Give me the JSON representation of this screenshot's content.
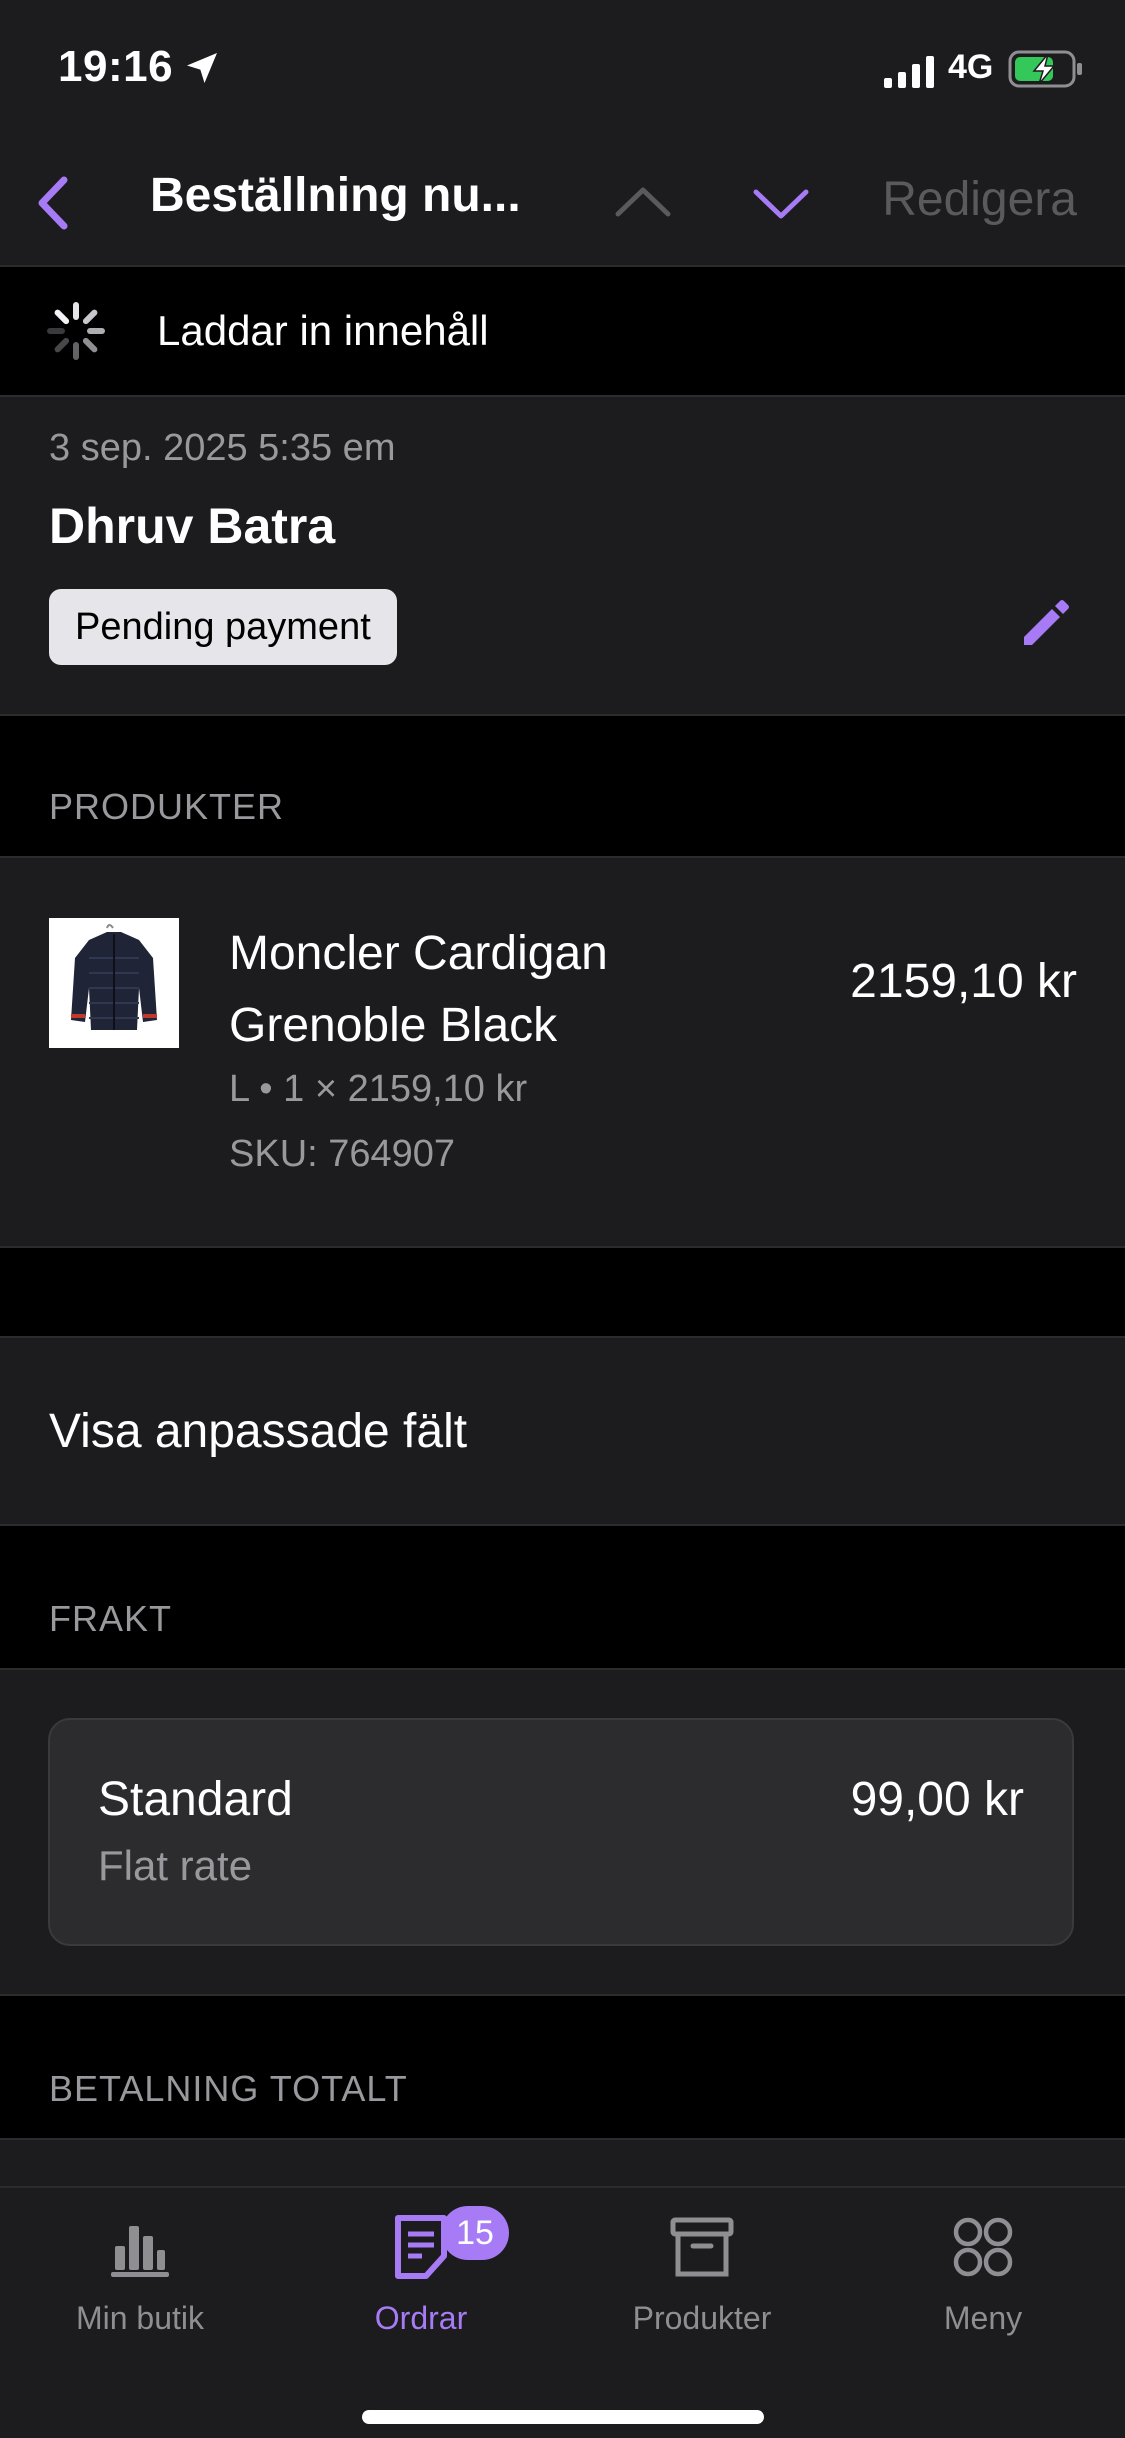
{
  "status_bar": {
    "time": "19:16",
    "network": "4G",
    "icons": [
      "location-arrow-icon",
      "signal-icon",
      "battery-charging-icon"
    ]
  },
  "nav": {
    "title": "Beställning nu...",
    "edit_label": "Redigera",
    "accent": "#a67bf5",
    "icons": [
      "back-chevron-icon",
      "chevron-up-icon",
      "chevron-down-icon"
    ]
  },
  "loading": {
    "text": "Laddar in innehåll"
  },
  "order": {
    "date": "3 sep. 2025 5:35 em",
    "customer": "Dhruv Batra",
    "status": "Pending payment"
  },
  "sections": {
    "products": "PRODUKTER",
    "shipping": "FRAKT",
    "payment": "BETALNING TOTALT"
  },
  "product": {
    "name": "Moncler Cardigan Grenoble Black",
    "price": "2159,10 kr",
    "meta": "L • 1 × 2159,10 kr",
    "sku": "SKU: 764907"
  },
  "custom_fields": {
    "label": "Visa anpassade fält"
  },
  "shipping": {
    "name": "Standard",
    "price": "99,00 kr",
    "type": "Flat rate"
  },
  "tabs": [
    {
      "label": "Min butik",
      "icon": "bar-chart-icon"
    },
    {
      "label": "Ordrar",
      "icon": "orders-icon",
      "badge": "15"
    },
    {
      "label": "Produkter",
      "icon": "archive-box-icon"
    },
    {
      "label": "Meny",
      "icon": "grid-circles-icon"
    }
  ]
}
